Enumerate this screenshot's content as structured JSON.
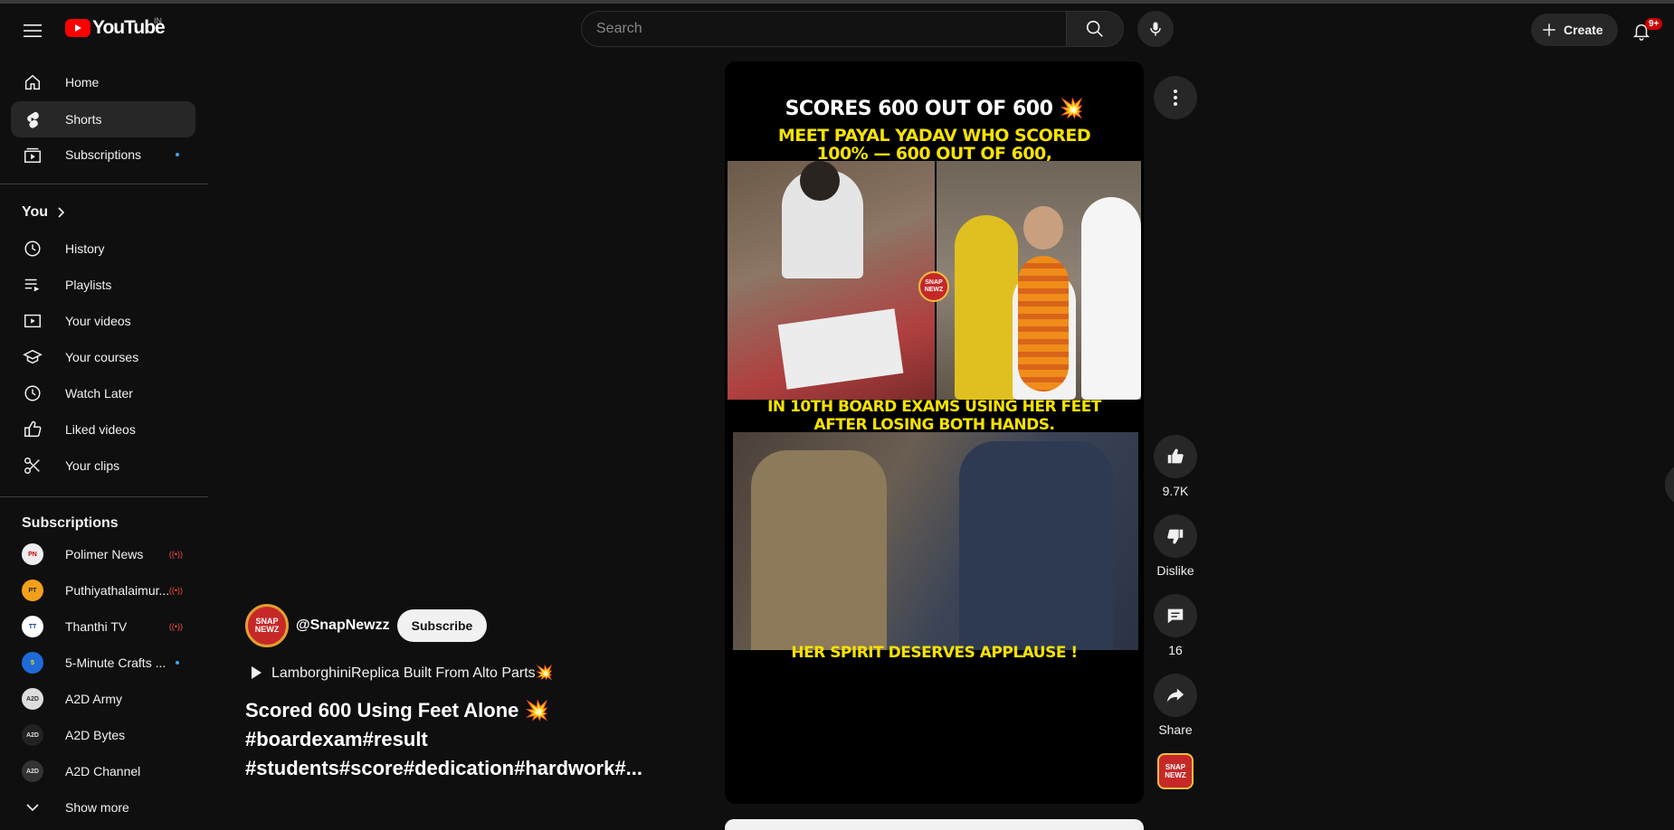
{
  "header": {
    "logo_text": "YouTube",
    "country_code": "IN",
    "search_placeholder": "Search",
    "create_label": "Create",
    "notifications_badge": "9+"
  },
  "sidebar": {
    "main": [
      {
        "label": "Home",
        "icon": "home-icon"
      },
      {
        "label": "Shorts",
        "icon": "shorts-icon",
        "active": true
      },
      {
        "label": "Subscriptions",
        "icon": "subscriptions-icon"
      }
    ],
    "you_heading": "You",
    "you_items": [
      {
        "label": "History",
        "icon": "history-icon"
      },
      {
        "label": "Playlists",
        "icon": "playlists-icon"
      },
      {
        "label": "Your videos",
        "icon": "your-videos-icon"
      },
      {
        "label": "Your courses",
        "icon": "courses-icon"
      },
      {
        "label": "Watch Later",
        "icon": "clock-icon"
      },
      {
        "label": "Liked videos",
        "icon": "thumbs-up-icon"
      },
      {
        "label": "Your clips",
        "icon": "scissors-icon"
      }
    ],
    "subs_heading": "Subscriptions",
    "subscriptions": [
      {
        "label": "Polimer News",
        "status": "live"
      },
      {
        "label": "Puthiyathalaimur...",
        "status": "live"
      },
      {
        "label": "Thanthi TV",
        "status": "live"
      },
      {
        "label": "5-Minute Crafts ...",
        "status": "new"
      },
      {
        "label": "A2D Army",
        "status": ""
      },
      {
        "label": "A2D Bytes",
        "status": ""
      },
      {
        "label": "A2D Channel",
        "status": ""
      }
    ],
    "show_more": "Show more"
  },
  "short": {
    "channel_handle": "@SnapNewzz",
    "channel_logo_text": "SNAP NEWZ",
    "subscribe_label": "Subscribe",
    "related_video": "LamborghiniReplica Built From Alto Parts💥",
    "title": "Scored 600 Using Feet Alone 💥 #boardexam#result #students#score#dedication#hardwork#...",
    "overlay_top": "SCORES 600 OUT OF 600 💥",
    "overlay_sub1": "MEET PAYAL YADAV WHO SCORED",
    "overlay_sub2": "100% — 600 OUT OF 600,",
    "overlay_mid1": "IN 10TH BOARD EXAMS USING HER FEET",
    "overlay_mid2": "AFTER LOSING BOTH HANDS.",
    "overlay_bottom": "HER SPIRIT DESERVES APPLAUSE !"
  },
  "actions": {
    "likes": "9.7K",
    "dislike_label": "Dislike",
    "comments": "16",
    "share_label": "Share"
  },
  "colors": {
    "brand_red": "#ff0000",
    "overlay_yellow": "#f5e200",
    "live_red": "#ff4e45",
    "new_dot_blue": "#3ea6ff"
  }
}
